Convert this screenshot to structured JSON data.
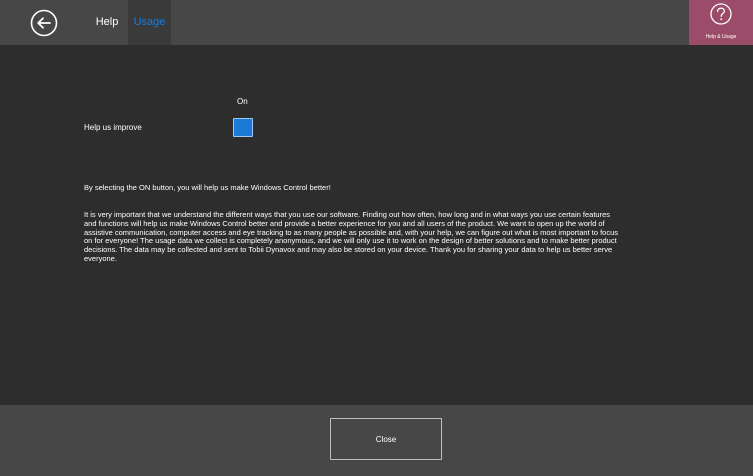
{
  "header": {
    "back_icon": "back-arrow-icon",
    "tabs": [
      {
        "label": "Help"
      },
      {
        "label": "Usage"
      }
    ],
    "help_usage": {
      "icon": "question-mark-icon",
      "label": "Help & Usage",
      "color": "#9a4c68"
    },
    "accent_color": "#1a7ad6"
  },
  "settings": {
    "toggle_state_label": "On",
    "help_us_improve_label": "Help us improve",
    "toggle_on": true
  },
  "body": {
    "selecting_text": "By selecting the ON button, you will help us make Windows Control better!",
    "description": "It is very important that we understand the different ways that you use our software. Finding out how often, how long and in what ways you use certain features and functions will help us make Windows Control better and provide a better experience for you and all users of the product. We want to open up the world of assistive communication, computer access and eye tracking to as many people as possible and, with your help, we can figure out what is most important to focus on for everyone! The usage data we collect is completely anonymous, and we will only use it to work on the design of better solutions and to make better product decisions. The data may be collected and sent to Tobii Dynavox and may also be stored on your device. Thank you for sharing your data to help us better serve everyone."
  },
  "footer": {
    "close_label": "Close"
  }
}
